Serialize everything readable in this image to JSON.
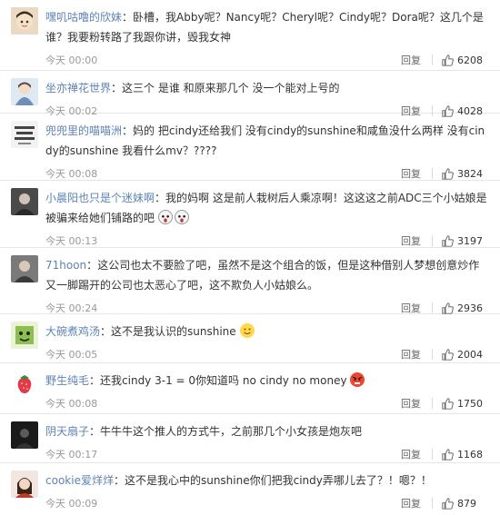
{
  "comments": [
    {
      "user": "嘿叽咕噜的欣妹",
      "sep": "：",
      "text": "卧槽，我Abby呢？Nancy呢？Cheryl呢？Cindy呢？Dora呢？这几个是谁？我要粉转路了我跟你讲，毁我女神",
      "time": "今天 00:00",
      "reply": "回复",
      "likes": "6208",
      "avatar_icon": "cartoon-face-icon",
      "avatar_color": "#c9b9a8"
    },
    {
      "user": "坐亦禅花世界",
      "sep": "：",
      "text": "这三个 是谁 和原来那几个 没一个能对上号的",
      "time": "今天 00:02",
      "reply": "回复",
      "likes": "4028",
      "avatar_icon": "anime-avatar-icon",
      "avatar_color": "#8aa7c9"
    },
    {
      "user": "兜兜里的喵喵洲",
      "sep": "：",
      "text": "妈的 把cindy还给我们 没有cindy的sunshine和咸鱼没什么两样 没有cindy的sunshine 我看什么mv？????",
      "time": "今天 00:08",
      "reply": "回复",
      "likes": "3824",
      "avatar_icon": "text-avatar-icon",
      "avatar_color": "#e8e8e8"
    },
    {
      "user": "小晨阳也只是个迷妹啊",
      "sep": "：",
      "text": "我的妈啊 这是前人栽树后人乘凉啊！这这这之前ADC三个小姑娘是被骗来给她们铺路的吧",
      "time": "今天 00:13",
      "reply": "回复",
      "likes": "3197",
      "avatar_icon": "photo-avatar-icon",
      "avatar_color": "#555555"
    },
    {
      "user": "71hoon",
      "sep": "：",
      "text": "这公司也太不要脸了吧，虽然不是这个组合的饭，但是这种借别人梦想创意炒作又一脚踢开的公司也太恶心了吧，这不欺负人小姑娘么。",
      "time": "今天 00:24",
      "reply": "回复",
      "likes": "2936",
      "avatar_icon": "photo-avatar-icon",
      "avatar_color": "#6b6b6b"
    },
    {
      "user": "大碗煮鸡汤",
      "sep": "：",
      "text": "这不是我认识的sunshine",
      "time": "今天 00:05",
      "reply": "回复",
      "likes": "2004",
      "avatar_icon": "cartoon-face-icon",
      "avatar_color": "#9bc36b"
    },
    {
      "user": "野生纯毛",
      "sep": "：",
      "text": "还我cindy 3-1 = 0你知道吗 no cindy no money",
      "time": "今天 00:08",
      "reply": "回复",
      "likes": "1750",
      "avatar_icon": "strawberry-icon",
      "avatar_color": "#ffffff"
    },
    {
      "user": "阴天扇子",
      "sep": "：",
      "text": "牛牛牛这个推人的方式牛，之前那几个小女孩是炮灰吧",
      "time": "今天 00:17",
      "reply": "回复",
      "likes": "1168",
      "avatar_icon": "photo-avatar-icon",
      "avatar_color": "#222222"
    },
    {
      "user": "cookie爱烊烊",
      "sep": "：",
      "text": "这不是我心中的sunshine你们把我cindy弄哪儿去了？！嗯？！",
      "time": "今天 00:09",
      "reply": "回复",
      "likes": "879",
      "avatar_icon": "photo-avatar-icon",
      "avatar_color": "#a77b6a"
    }
  ]
}
